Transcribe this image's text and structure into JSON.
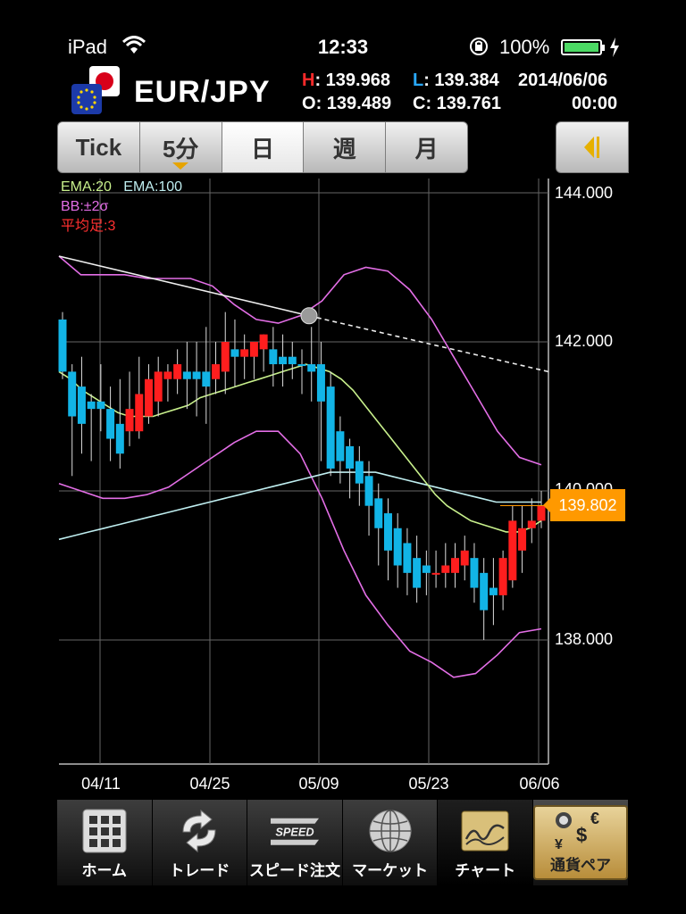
{
  "status_bar": {
    "carrier": "iPad",
    "time": "12:33",
    "battery": "100%"
  },
  "header": {
    "pair": "EUR/JPY",
    "high_key": "H",
    "high": ": 139.968",
    "low_key": "L",
    "low": ": 139.384",
    "date": "2014/06/06",
    "open_key": "O",
    "open": ": 139.489",
    "close_key": "C",
    "close": ": 139.761",
    "time": "00:00"
  },
  "tabs": [
    {
      "label": "Tick"
    },
    {
      "label": "5分"
    },
    {
      "label": "日"
    },
    {
      "label": "週"
    },
    {
      "label": "月"
    }
  ],
  "active_tab": "日",
  "legend": {
    "ema20": "EMA:20",
    "ema100": "EMA:100",
    "bb": "BB:±2σ",
    "ha": "平均足:3"
  },
  "colors": {
    "ema20": "#c8f08c",
    "ema100": "#bfeef0",
    "bb": "#e36ee6",
    "ha": "#ff3030",
    "up": "#ff1e1e",
    "down": "#12b4e6",
    "price_tag": "#ff9900"
  },
  "current_price": "139.802",
  "chart_data": {
    "type": "candlestick",
    "ylim": [
      136.2,
      144.2
    ],
    "y_ticks": [
      "144.000",
      "142.000",
      "140.000",
      "138.000"
    ],
    "x_ticks": [
      "04/11",
      "04/25",
      "05/09",
      "05/23",
      "06/06"
    ],
    "candles": [
      {
        "o": 142.3,
        "h": 142.4,
        "c": 141.6,
        "l": 141.5,
        "d": "down"
      },
      {
        "o": 141.6,
        "h": 141.7,
        "c": 141.0,
        "l": 140.2,
        "d": "down"
      },
      {
        "o": 141.4,
        "h": 141.8,
        "c": 140.9,
        "l": 140.5,
        "d": "down"
      },
      {
        "o": 141.2,
        "h": 141.3,
        "c": 141.1,
        "l": 140.4,
        "d": "down"
      },
      {
        "o": 141.2,
        "h": 141.7,
        "c": 141.1,
        "l": 140.8,
        "d": "down"
      },
      {
        "o": 141.1,
        "h": 141.4,
        "c": 140.7,
        "l": 140.4,
        "d": "down"
      },
      {
        "o": 140.9,
        "h": 141.5,
        "c": 140.5,
        "l": 140.3,
        "d": "down"
      },
      {
        "o": 140.8,
        "h": 141.6,
        "c": 141.1,
        "l": 140.6,
        "d": "up"
      },
      {
        "o": 140.8,
        "h": 141.8,
        "c": 141.3,
        "l": 140.7,
        "d": "up"
      },
      {
        "o": 141.0,
        "h": 141.7,
        "c": 141.5,
        "l": 140.9,
        "d": "up"
      },
      {
        "o": 141.2,
        "h": 141.8,
        "c": 141.6,
        "l": 141.0,
        "d": "up"
      },
      {
        "o": 141.5,
        "h": 141.7,
        "c": 141.6,
        "l": 141.2,
        "d": "up"
      },
      {
        "o": 141.5,
        "h": 141.9,
        "c": 141.7,
        "l": 141.3,
        "d": "up"
      },
      {
        "o": 141.6,
        "h": 142.0,
        "c": 141.5,
        "l": 141.1,
        "d": "down"
      },
      {
        "o": 141.6,
        "h": 142.0,
        "c": 141.5,
        "l": 141.0,
        "d": "down"
      },
      {
        "o": 141.6,
        "h": 142.2,
        "c": 141.4,
        "l": 140.9,
        "d": "down"
      },
      {
        "o": 141.5,
        "h": 142.0,
        "c": 141.7,
        "l": 141.3,
        "d": "up"
      },
      {
        "o": 141.6,
        "h": 142.4,
        "c": 142.0,
        "l": 141.3,
        "d": "up"
      },
      {
        "o": 141.9,
        "h": 142.3,
        "c": 141.8,
        "l": 141.4,
        "d": "down"
      },
      {
        "o": 141.8,
        "h": 142.1,
        "c": 141.9,
        "l": 141.5,
        "d": "up"
      },
      {
        "o": 141.8,
        "h": 142.0,
        "c": 142.0,
        "l": 141.5,
        "d": "up"
      },
      {
        "o": 141.9,
        "h": 142.1,
        "c": 142.1,
        "l": 141.6,
        "d": "up"
      },
      {
        "o": 141.9,
        "h": 142.2,
        "c": 141.7,
        "l": 141.4,
        "d": "down"
      },
      {
        "o": 141.8,
        "h": 142.1,
        "c": 141.7,
        "l": 141.4,
        "d": "down"
      },
      {
        "o": 141.8,
        "h": 142.0,
        "c": 141.7,
        "l": 141.5,
        "d": "down"
      },
      {
        "o": 141.7,
        "h": 141.9,
        "c": 141.7,
        "l": 141.3,
        "d": "down"
      },
      {
        "o": 141.7,
        "h": 142.2,
        "c": 141.6,
        "l": 141.2,
        "d": "down"
      },
      {
        "o": 141.7,
        "h": 142.0,
        "c": 141.2,
        "l": 140.4,
        "d": "down"
      },
      {
        "o": 141.4,
        "h": 141.6,
        "c": 140.3,
        "l": 140.2,
        "d": "down"
      },
      {
        "o": 140.8,
        "h": 141.0,
        "c": 140.4,
        "l": 140.1,
        "d": "down"
      },
      {
        "o": 140.6,
        "h": 140.7,
        "c": 140.3,
        "l": 139.9,
        "d": "down"
      },
      {
        "o": 140.4,
        "h": 140.6,
        "c": 140.1,
        "l": 139.8,
        "d": "down"
      },
      {
        "o": 140.2,
        "h": 140.4,
        "c": 139.8,
        "l": 139.4,
        "d": "down"
      },
      {
        "o": 139.9,
        "h": 140.1,
        "c": 139.5,
        "l": 139.0,
        "d": "down"
      },
      {
        "o": 139.7,
        "h": 139.9,
        "c": 139.2,
        "l": 138.8,
        "d": "down"
      },
      {
        "o": 139.5,
        "h": 139.7,
        "c": 139.0,
        "l": 138.7,
        "d": "down"
      },
      {
        "o": 139.3,
        "h": 139.5,
        "c": 138.9,
        "l": 138.6,
        "d": "down"
      },
      {
        "o": 139.1,
        "h": 139.4,
        "c": 138.7,
        "l": 138.5,
        "d": "down"
      },
      {
        "o": 139.0,
        "h": 139.2,
        "c": 138.9,
        "l": 138.6,
        "d": "down"
      },
      {
        "o": 138.9,
        "h": 139.2,
        "c": 138.9,
        "l": 138.7,
        "d": "up"
      },
      {
        "o": 138.9,
        "h": 139.3,
        "c": 139.0,
        "l": 138.7,
        "d": "up"
      },
      {
        "o": 138.9,
        "h": 139.3,
        "c": 139.1,
        "l": 138.7,
        "d": "up"
      },
      {
        "o": 139.0,
        "h": 139.4,
        "c": 139.2,
        "l": 138.8,
        "d": "up"
      },
      {
        "o": 139.1,
        "h": 139.3,
        "c": 138.7,
        "l": 138.5,
        "d": "down"
      },
      {
        "o": 138.9,
        "h": 139.1,
        "c": 138.4,
        "l": 138.0,
        "d": "down"
      },
      {
        "o": 138.7,
        "h": 139.1,
        "c": 138.6,
        "l": 138.2,
        "d": "down"
      },
      {
        "o": 138.6,
        "h": 139.2,
        "c": 139.1,
        "l": 138.4,
        "d": "up"
      },
      {
        "o": 138.8,
        "h": 139.8,
        "c": 139.6,
        "l": 138.7,
        "d": "up"
      },
      {
        "o": 139.2,
        "h": 139.8,
        "c": 139.5,
        "l": 138.9,
        "d": "up"
      },
      {
        "o": 139.5,
        "h": 139.9,
        "c": 139.6,
        "l": 139.3,
        "d": "up"
      },
      {
        "o": 139.6,
        "h": 140.0,
        "c": 139.8,
        "l": 139.5,
        "d": "up"
      }
    ],
    "ema20": [
      141.6,
      141.5,
      141.35,
      141.25,
      141.15,
      141.05,
      141.0,
      141.0,
      141.0,
      141.05,
      141.1,
      141.15,
      141.25,
      141.3,
      141.35,
      141.4,
      141.45,
      141.5,
      141.55,
      141.6,
      141.65,
      141.7,
      141.65,
      141.6,
      141.5,
      141.35,
      141.15,
      140.95,
      140.75,
      140.55,
      140.35,
      140.15,
      139.95,
      139.8,
      139.7,
      139.6,
      139.55,
      139.5,
      139.45,
      139.45,
      139.5,
      139.6
    ],
    "ema100": [
      139.35,
      139.4,
      139.45,
      139.5,
      139.55,
      139.6,
      139.65,
      139.7,
      139.75,
      139.8,
      139.85,
      139.9,
      139.95,
      140.0,
      140.05,
      140.1,
      140.15,
      140.2,
      140.25,
      140.25,
      140.25,
      140.25,
      140.2,
      140.15,
      140.1,
      140.05,
      140.0,
      139.95,
      139.9,
      139.85,
      139.85,
      139.85,
      139.85
    ],
    "bb_upper": [
      143.15,
      142.9,
      142.9,
      142.9,
      142.85,
      142.85,
      142.85,
      142.75,
      142.5,
      142.3,
      142.25,
      142.35,
      142.55,
      142.9,
      143.0,
      142.95,
      142.7,
      142.3,
      141.8,
      141.3,
      140.8,
      140.45,
      140.35
    ],
    "bb_lower": [
      140.1,
      140.0,
      139.9,
      139.9,
      139.95,
      140.05,
      140.25,
      140.45,
      140.65,
      140.8,
      140.8,
      140.5,
      139.9,
      139.2,
      138.6,
      138.2,
      137.85,
      137.7,
      137.5,
      137.55,
      137.8,
      138.1,
      138.15
    ],
    "ha_line": [
      143.15,
      142.5,
      142.3,
      141.6
    ]
  },
  "toolbar": [
    {
      "label": "ホーム",
      "icon": "home-grid-icon"
    },
    {
      "label": "トレード",
      "icon": "trade-arrows-icon"
    },
    {
      "label": "スピード注文",
      "icon": "speed-icon"
    },
    {
      "label": "マーケット",
      "icon": "globe-icon"
    },
    {
      "label": "チャート",
      "icon": "chart-icon"
    },
    {
      "label": "通貨ペア",
      "icon": "currency-pair-icon"
    }
  ],
  "speed_icon_text": "SPEED"
}
